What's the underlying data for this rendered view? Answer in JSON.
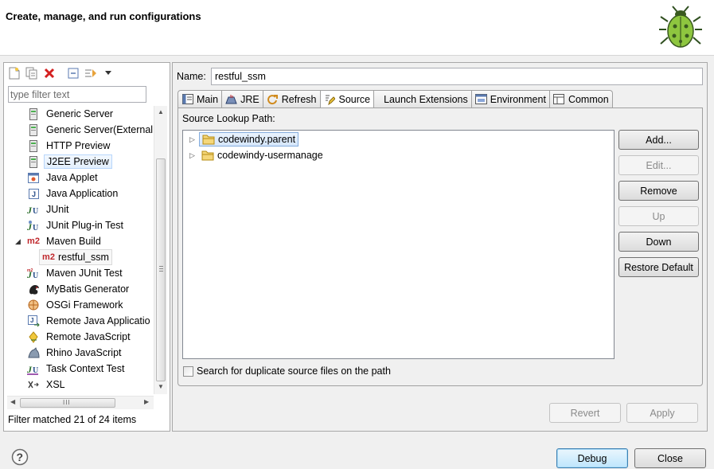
{
  "header": {
    "title": "Create, manage, and run configurations",
    "icon": "bug-icon"
  },
  "left": {
    "toolbar": [
      "new-config-icon",
      "duplicate-icon",
      "delete-icon",
      "collapse-all-icon",
      "filter-icon",
      "dropdown-arrow-icon"
    ],
    "filter_placeholder": "type filter text",
    "tree": [
      {
        "label": "Generic Server",
        "icon": "server-icon"
      },
      {
        "label": "Generic Server(External",
        "icon": "server-icon"
      },
      {
        "label": "HTTP Preview",
        "icon": "server-icon"
      },
      {
        "label": "J2EE Preview",
        "icon": "server-icon"
      },
      {
        "label": "Java Applet",
        "icon": "applet-icon"
      },
      {
        "label": "Java Application",
        "icon": "java-app-icon"
      },
      {
        "label": "JUnit",
        "icon": "junit-icon"
      },
      {
        "label": "JUnit Plug-in Test",
        "icon": "junit-plugin-icon"
      },
      {
        "label": "Maven Build",
        "icon": "maven-icon"
      },
      {
        "label": "restful_ssm",
        "icon": "maven-icon"
      },
      {
        "label": "Maven JUnit Test",
        "icon": "junit-icon"
      },
      {
        "label": "MyBatis Generator",
        "icon": "mybatis-icon"
      },
      {
        "label": "OSGi Framework",
        "icon": "osgi-icon"
      },
      {
        "label": "Remote Java Applicatio",
        "icon": "remote-java-icon"
      },
      {
        "label": "Remote JavaScript",
        "icon": "remote-js-icon"
      },
      {
        "label": "Rhino JavaScript",
        "icon": "rhino-icon"
      },
      {
        "label": "Task Context Test",
        "icon": "junit-icon"
      },
      {
        "label": "XSL",
        "icon": "xsl-icon"
      }
    ],
    "m2_text": "m2",
    "hscroll_grip": "III",
    "filter_status": "Filter matched 21 of 24 items"
  },
  "right": {
    "name_label": "Name:",
    "name_value": "restful_ssm",
    "tabs": [
      {
        "label": "Main",
        "icon": "main-tab-icon"
      },
      {
        "label": "JRE",
        "icon": "jre-icon"
      },
      {
        "label": "Refresh",
        "icon": "refresh-icon"
      },
      {
        "label": "Source",
        "icon": "source-icon",
        "active": true
      },
      {
        "label": "Launch Extensions",
        "icon": ""
      },
      {
        "label": "Environment",
        "icon": "environment-icon"
      },
      {
        "label": "Common",
        "icon": "common-icon"
      }
    ],
    "source_lookup_label": "Source Lookup Path:",
    "source_items": [
      "codewindy.parent",
      "codewindy-usermanage"
    ],
    "buttons": {
      "add": "Add...",
      "edit": "Edit...",
      "remove": "Remove",
      "up": "Up",
      "down": "Down",
      "restore_default": "Restore Default"
    },
    "duplicate_checkbox_label": "Search for duplicate source files on the path",
    "revert": "Revert",
    "apply": "Apply"
  },
  "footer": {
    "debug": "Debug",
    "close": "Close",
    "help_icon": "help-icon"
  }
}
